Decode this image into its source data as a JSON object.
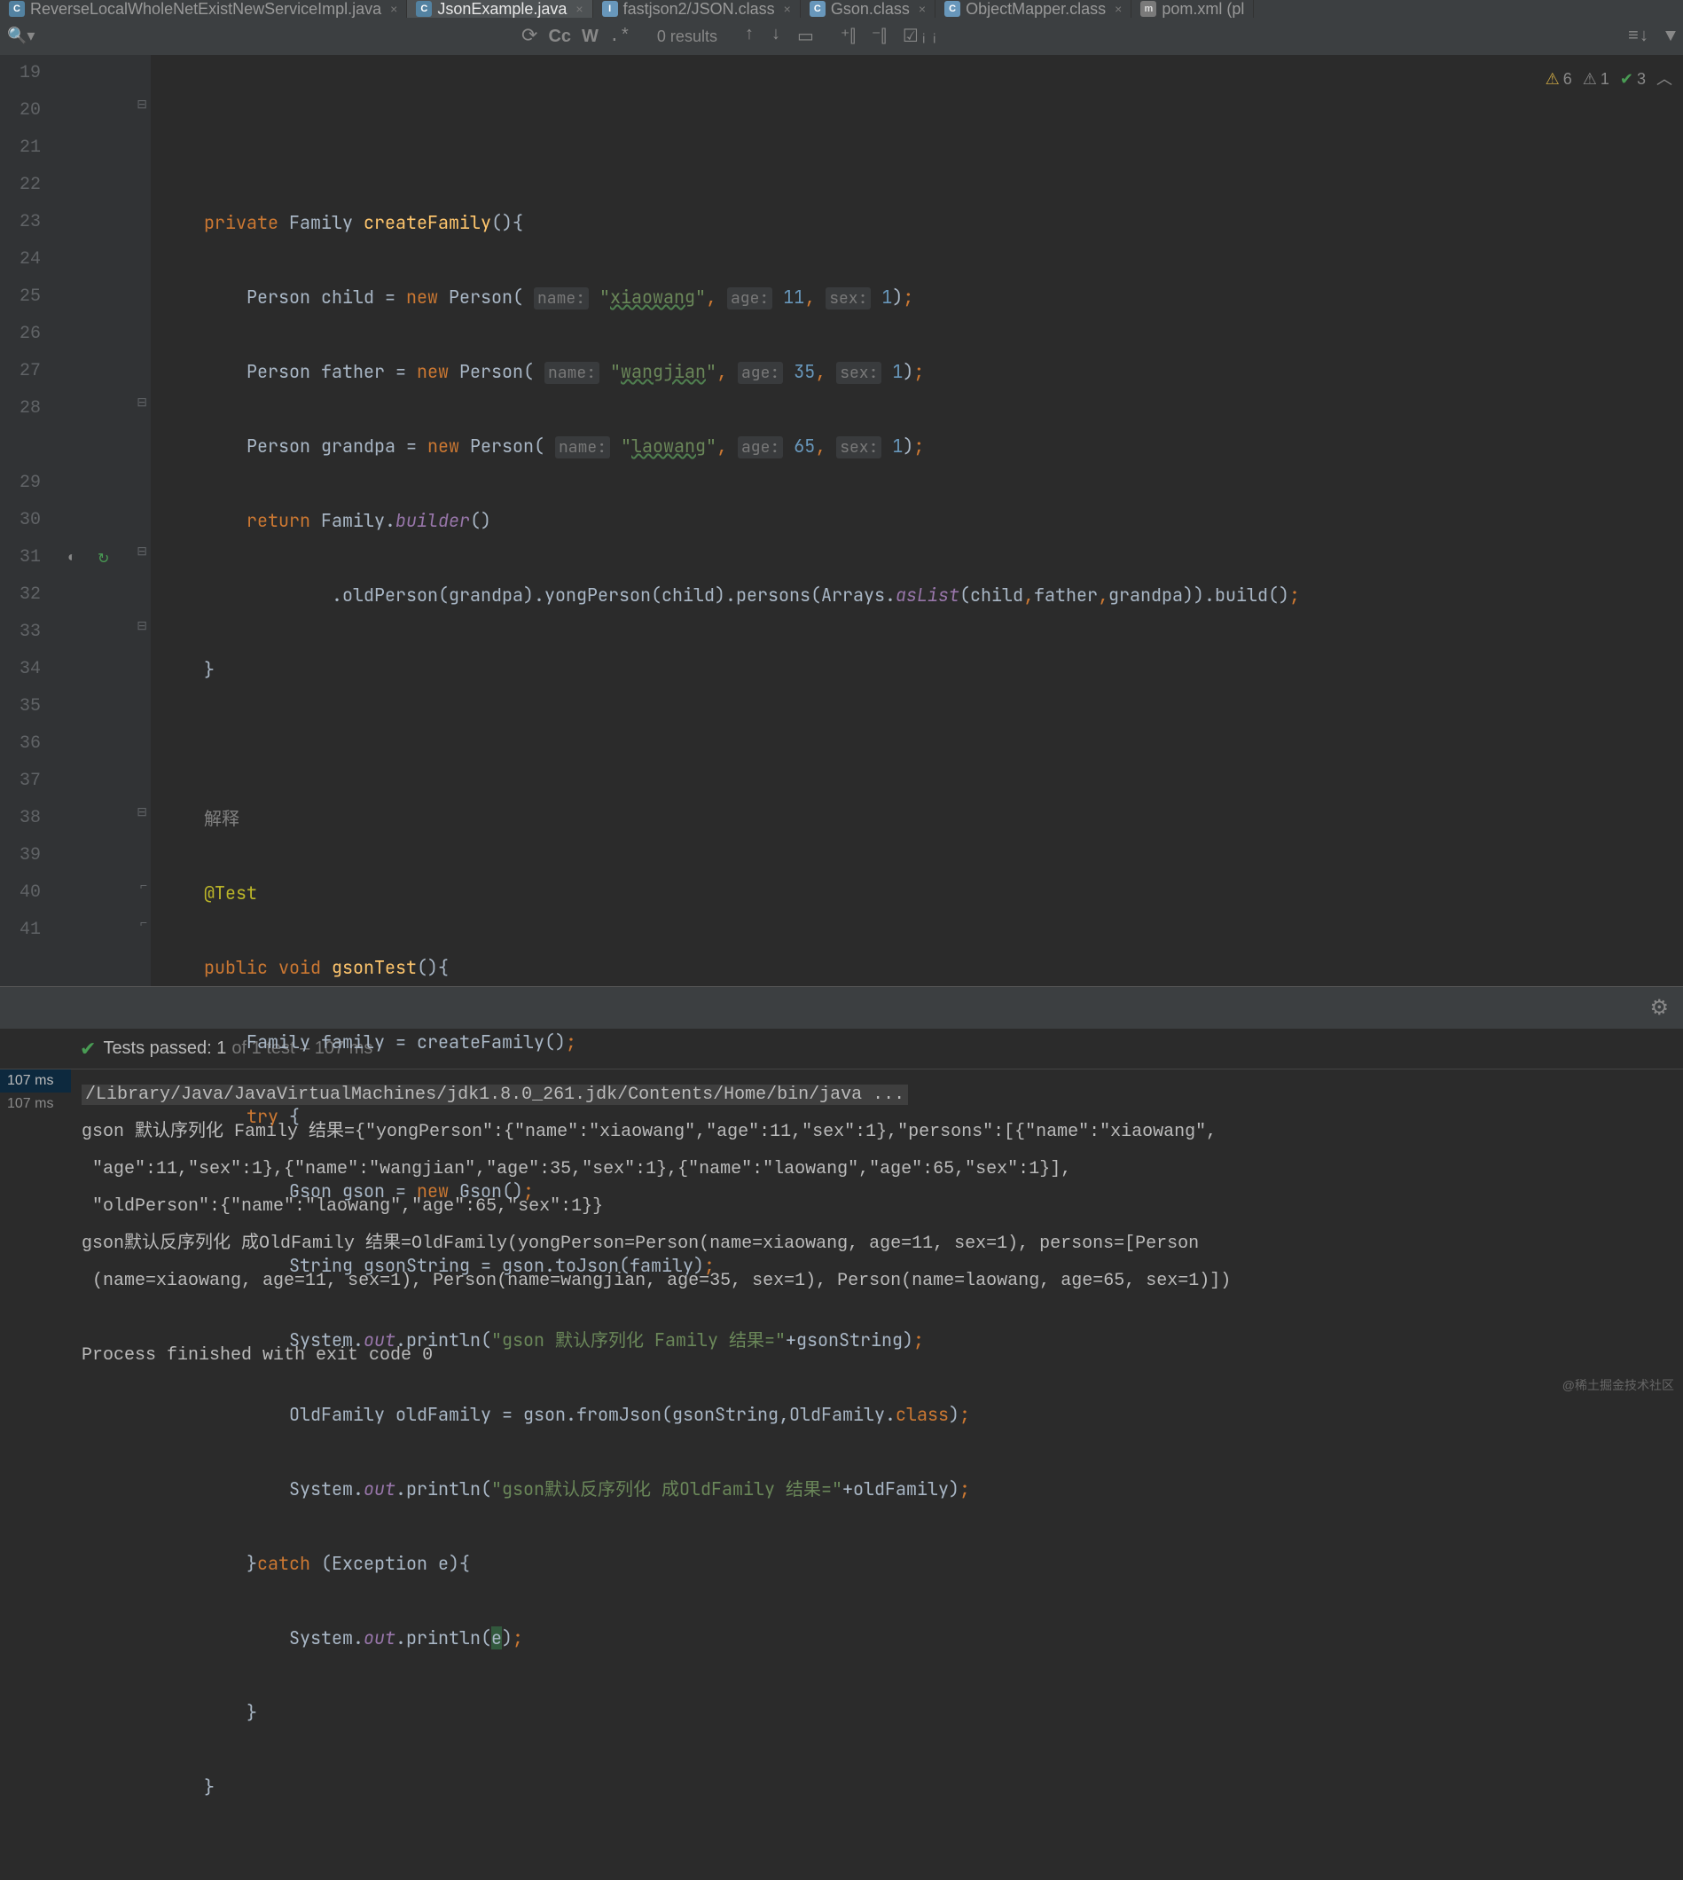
{
  "tabs": [
    {
      "name": "ReverseLocalWholeNetExistNewServiceImpl.java",
      "iconType": "java",
      "active": false
    },
    {
      "name": "JsonExample.java",
      "iconType": "java",
      "active": true
    },
    {
      "name": "fastjson2/JSON.class",
      "iconType": "class",
      "active": false
    },
    {
      "name": "Gson.class",
      "iconType": "class",
      "active": false
    },
    {
      "name": "ObjectMapper.class",
      "iconType": "class",
      "active": false
    },
    {
      "name": "pom.xml (pl",
      "iconType": "xml",
      "active": false
    }
  ],
  "search": {
    "results": "0 results"
  },
  "inspections": {
    "warning": {
      "icon": "⚠",
      "count": "6"
    },
    "weak": {
      "icon": "⚠",
      "count": "1"
    },
    "typo": {
      "icon": "✔",
      "count": "3"
    }
  },
  "lineStart": 19,
  "lineEnd": 41,
  "code": {
    "l20_priv": "private",
    "l20_type": "Family",
    "l20_method": "createFamily",
    "l21_type": "Person",
    "l21_var": "child",
    "l21_eq": "=",
    "l21_new": "new",
    "l21_cls": "Person",
    "l21_h1": "name:",
    "l21_s1": "\"xiaowang\"",
    "l21_h2": "age:",
    "l21_n1": "11",
    "l21_h3": "sex:",
    "l21_n2": "1",
    "l22_var": "father",
    "l22_s1": "\"wangjian\"",
    "l22_n1": "35",
    "l22_n2": "1",
    "l23_var": "grandpa",
    "l23_s1": "\"laowang\"",
    "l23_n1": "65",
    "l23_n2": "1",
    "l24_ret": "return",
    "l24_type": "Family",
    "l24_builder": "builder",
    "l25_text": ".oldPerson(grandpa).yongPerson(child).persons(Arrays.",
    "l25_asList": "asList",
    "l25_tail": "(child,father,grandpa)).build();",
    "l28_comment": "解释",
    "l29_anno": "@Test",
    "l30_pub": "public",
    "l30_void": "void",
    "l30_method": "gsonTest",
    "l31_decl": "Family family = createFamily()",
    "l32_try": "try",
    "l33_new": "new",
    "l33_decl_pre": "Gson gson = ",
    "l33_decl_post": " Gson()",
    "l34_decl": "String gsonString = gson.toJson(family)",
    "l35_sys": "System.",
    "l35_out": "out",
    "l35_println": ".println(",
    "l35_str": "\"gson 默认序列化 Family 结果=\"",
    "l35_tail": "+gsonString)",
    "l36_decl": "OldFamily oldFamily = gson.fromJson(gsonString,OldFamily.",
    "l36_class": "class",
    "l36_tail": ")",
    "l37_str": "\"gson默认反序列化 成OldFamily 结果=\"",
    "l37_tail": "+oldFamily)",
    "l38_catch": "catch",
    "l38_decl": " (Exception e){",
    "l39_e": "e",
    "l39_tail": ")"
  },
  "testStatus": {
    "passed": "Tests passed: 1",
    "detail": "of 1 test – 107 ms"
  },
  "consoleLeft": {
    "time1": "107 ms",
    "time2": "107 ms"
  },
  "console": {
    "cmd": "/Library/Java/JavaVirtualMachines/jdk1.8.0_261.jdk/Contents/Home/bin/java ...",
    "line2": "gson 默认序列化 Family 结果={\"yongPerson\":{\"name\":\"xiaowang\",\"age\":11,\"sex\":1},\"persons\":[{\"name\":\"xiaowang\",",
    "line3": " \"age\":11,\"sex\":1},{\"name\":\"wangjian\",\"age\":35,\"sex\":1},{\"name\":\"laowang\",\"age\":65,\"sex\":1}],",
    "line4": " \"oldPerson\":{\"name\":\"laowang\",\"age\":65,\"sex\":1}}",
    "line5": "gson默认反序列化 成OldFamily 结果=OldFamily(yongPerson=Person(name=xiaowang, age=11, sex=1), persons=[Person",
    "line6": " (name=xiaowang, age=11, sex=1), Person(name=wangjian, age=35, sex=1), Person(name=laowang, age=65, sex=1)])",
    "line7": "",
    "line8": "Process finished with exit code 0"
  },
  "watermark": "@稀土掘金技术社区"
}
